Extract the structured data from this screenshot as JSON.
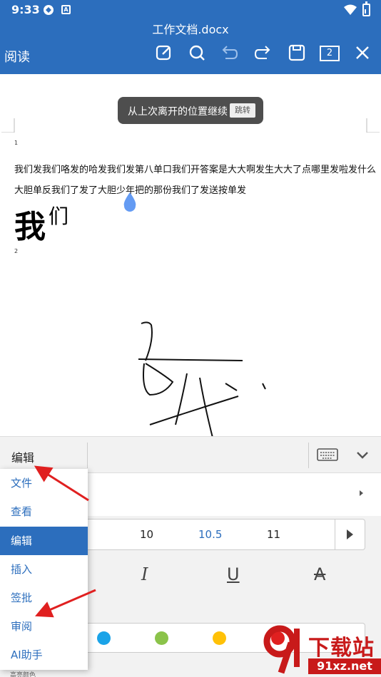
{
  "status_bar": {
    "time": "9:33",
    "badge_letter": "A"
  },
  "header": {
    "doc_title": "工作文档.docx",
    "mode_label": "阅读",
    "page_count": "2",
    "icons": [
      "edit-icon",
      "search-icon",
      "undo-icon",
      "redo-icon",
      "save-icon",
      "close-icon"
    ]
  },
  "toast": {
    "text": "从上次离开的位置继续",
    "button": "跳转"
  },
  "document": {
    "page1_number": "1",
    "line1": "我们发我们咯发的哈发我们发第八单口我们开答案是大大啊发生大大了点哪里发啦发什么",
    "line2": "大胆单反我们了发了大胆少年把的那份我们了发送按单发",
    "big_char1": "我",
    "big_char2": "们",
    "page2_number": "2"
  },
  "panel": {
    "current_tab": "编辑",
    "font_sizes": [
      "10",
      "10.5",
      "11"
    ],
    "selected_font_size": "10.5",
    "style_buttons": [
      "I",
      "U",
      "A"
    ],
    "color_swatches": [
      "#1aa3e8",
      "#8bc34a",
      "#ffc107",
      "#e02020"
    ],
    "highlight_label": "高亮颜色"
  },
  "menu": {
    "items": [
      "文件",
      "查看",
      "编辑",
      "插入",
      "签批",
      "审阅",
      "AI助手"
    ],
    "active_item": "编辑"
  },
  "colors": {
    "brand": "#2c6ebd",
    "arrow": "#e02020",
    "watermark": "#c81a1a"
  },
  "watermark": {
    "title": "下载站",
    "url": "91xz.net"
  }
}
